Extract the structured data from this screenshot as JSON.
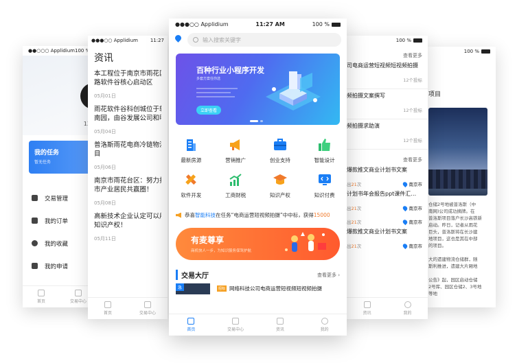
{
  "colors": {
    "primary": "#1a7ef5",
    "orange": "#f07a2b",
    "banner_start": "#6d52e8",
    "banner_end": "#33b9f2",
    "promo": "#ff6a30"
  },
  "profile_screen": {
    "status": {
      "carrier": "●●○○○ Applidium",
      "battery": "100 %"
    },
    "id_number": "137",
    "task_card": {
      "title": "我的任务",
      "subtitle": "暂无任务"
    },
    "menu": [
      {
        "label": "交易管理",
        "icon": "user-card-icon"
      },
      {
        "label": "我的订单",
        "icon": "order-icon"
      },
      {
        "label": "我的收藏",
        "icon": "heart-icon"
      },
      {
        "label": "我的申请",
        "icon": "checkbox-icon"
      }
    ],
    "tabs": [
      {
        "label": "首页"
      },
      {
        "label": "交易中心"
      }
    ]
  },
  "news_screen": {
    "status": {
      "carrier": "●●●○○ Applidium",
      "time": "11:27"
    },
    "title": "资讯",
    "items": [
      {
        "title": "本工程位于南京市雨花区",
        "title2": "路软件谷核心启动区",
        "date": "05月01日"
      },
      {
        "title": "雨花软件谷科创城位于软",
        "title2": "南园，由谷发展公司和明",
        "date": "05月04日"
      },
      {
        "title": "普洛斯雨花电商冷链物流",
        "title2": "目",
        "date": "05月06日"
      },
      {
        "title": "南京市雨花台区：努力打",
        "title2": "市产业居民共赢圈！",
        "date": "05月08日"
      },
      {
        "title": "高新技术企业认定可以用",
        "title2": "知识产权！",
        "date": "05月11日"
      }
    ],
    "tabs": [
      {
        "label": "首页"
      },
      {
        "label": "交易中心"
      }
    ]
  },
  "home_screen": {
    "status": {
      "carrier": "●●●○○ Applidium",
      "time": "11:27 AM",
      "battery": "100 %"
    },
    "search": {
      "placeholder": "输入搜索关键字"
    },
    "banner": {
      "title": "百种行业小程序开发",
      "subtitle": "多套方案任你选",
      "button": "立即查看"
    },
    "categories": [
      {
        "label": "最新房源",
        "icon": "building-icon"
      },
      {
        "label": "营销推广",
        "icon": "megaphone-icon"
      },
      {
        "label": "创业支持",
        "icon": "briefcase-icon"
      },
      {
        "label": "智能设计",
        "icon": "thumbs-up-icon"
      },
      {
        "label": "软件开发",
        "icon": "pencil-ruler-icon"
      },
      {
        "label": "工商财税",
        "icon": "chart-icon"
      },
      {
        "label": "知识产权",
        "icon": "graduation-cap-icon"
      },
      {
        "label": "知识付费",
        "icon": "code-monitor-icon"
      }
    ],
    "announcement": {
      "prefix": "恭喜",
      "name": "智能科技",
      "middle": "在任务“电商运营短视频拍摄”中中标，获得",
      "amount": "15000"
    },
    "promo": {
      "title": "有麦尊享",
      "subtitle": "商机快人一步，为知识服务保驾护航"
    },
    "hall": {
      "title": "交易大厅",
      "more": "查看更多",
      "urgent": "急",
      "tag": "招标",
      "item": "网络科技公司电商运营短视频短视频拍摄"
    },
    "tabs": [
      {
        "label": "首页"
      },
      {
        "label": "交易中心"
      },
      {
        "label": "资讯"
      },
      {
        "label": "我的"
      }
    ]
  },
  "hall_screen": {
    "status": {
      "battery": "100 %"
    },
    "more": "查看更多",
    "items": [
      {
        "title": "公司电商运营短视频短视频拍摄",
        "bids": "12个投标"
      },
      {
        "title": "视频拍摄文案撰写",
        "bids": "12个投标"
      },
      {
        "title": "视频拍摄求助演",
        "bids": "12个投标"
      }
    ],
    "more2": "查看更多",
    "items2": [
      {
        "title": "写爆款推文商业计划书文案",
        "views_pre": "出",
        "views": "21",
        "views_post": "次",
        "city": "南京市"
      },
      {
        "title": "业计划书年会报告ppt课件汇…",
        "views_pre": "出",
        "views": "21",
        "views_post": "次",
        "city": "南京市"
      },
      {
        "title": "",
        "views_pre": "出",
        "views": "21",
        "views_post": "次",
        "city": "南京市"
      },
      {
        "title": "写爆款推文商业计划书文案",
        "views_pre": "出",
        "views": "21",
        "views_post": "次",
        "city": "南京市"
      }
    ],
    "tabs": [
      {
        "label": "资讯"
      },
      {
        "label": "我的"
      }
    ]
  },
  "project_screen": {
    "status": {
      "battery": "100 %"
    },
    "title": "项目",
    "lines": [
      "仓储2号地被普洛斯（中",
      "南网)公司成功摘牌。在",
      "普洛斯项目落户长沙高铁新",
      "启动。昨日，记者从雨花",
      "巨头，普洛斯将在长沙建",
      "地项目，这也是其在中部",
      "的项目。",
      "",
      "大的遗建物流仓储群，随",
      "斯利推进，遗建大片厢地",
      "",
      "公告》起，园区启动仓储",
      "2号库、园区仓储2、3号地",
      "等地"
    ]
  }
}
